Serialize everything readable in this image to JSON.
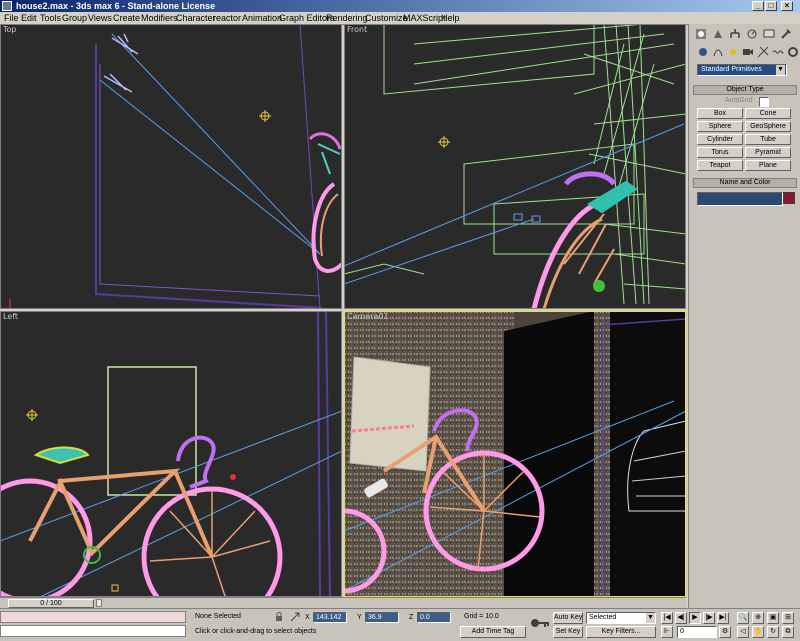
{
  "window": {
    "title": "house2.max - 3ds max 6 - Stand-alone License",
    "minimize": "_",
    "maximize": "□",
    "close": "×"
  },
  "menu": [
    "File",
    "Edit",
    "Tools",
    "Group",
    "Views",
    "Create",
    "Modifiers",
    "Character",
    "reactor",
    "Animation",
    "Graph Editors",
    "Rendering",
    "Customize",
    "MAXScript",
    "Help"
  ],
  "viewports": {
    "top": "Top",
    "front": "Front",
    "left": "Left",
    "camera": "Camera01"
  },
  "command_panel": {
    "tab_icons": [
      "create-tab-icon",
      "modify-tab-icon",
      "hierarchy-tab-icon",
      "motion-tab-icon",
      "display-tab-icon",
      "utilities-tab-icon"
    ],
    "category_icons": [
      "geometry-icon",
      "shapes-icon",
      "lights-icon",
      "cameras-icon",
      "helpers-icon",
      "space-warps-icon",
      "systems-icon"
    ],
    "dropdown": "Standard Primitives",
    "object_type_header": "Object Type",
    "autogrid": "AutoGrid",
    "buttons": [
      "Box",
      "Cone",
      "Sphere",
      "GeoSphere",
      "Cylinder",
      "Tube",
      "Torus",
      "Pyramid",
      "Teapot",
      "Plane"
    ],
    "name_color_header": "Name and Color",
    "swatch_color": "#8a1530"
  },
  "status": {
    "time_slider": "0 / 100",
    "selection": "None Selected",
    "prompt": "Click or click-and-drag to select objects",
    "x_label": "X",
    "x_value": "143.142",
    "y_label": "Y",
    "y_value": "36.9",
    "z_label": "Z",
    "z_value": "0.0",
    "grid": "Grid = 10.0",
    "add_time_tag": "Add Time Tag",
    "auto_key": "Auto Key",
    "selected_dropdown": "Selected",
    "set_key": "Set Key",
    "key_filters": "Key Filters...",
    "frame": "0"
  },
  "colors": {
    "viewport_bg": "#2a2a2a",
    "bike_pink": "#ff9ae8",
    "frame_orange": "#e8a070",
    "grid_green": "#a0e090",
    "wall_purple": "#5a3aa0",
    "camera_line": "#5aa0e8"
  }
}
